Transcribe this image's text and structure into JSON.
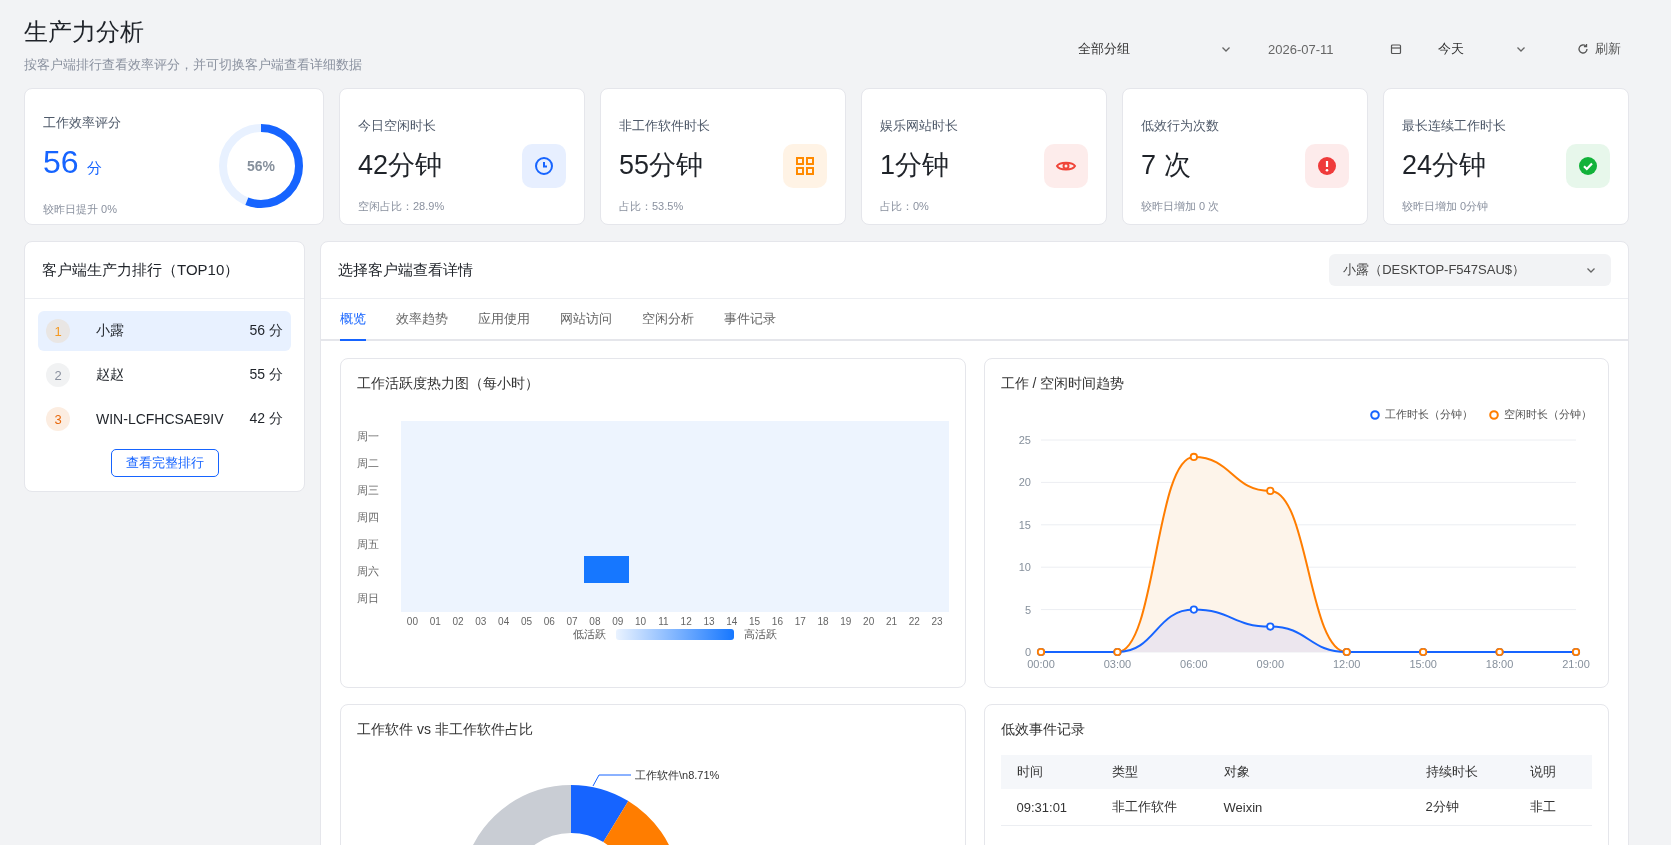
{
  "page": {
    "title": "生产力分析",
    "subtitle": "按客户端排行查看效率评分，并可切换客户端查看详细数据"
  },
  "filters": {
    "group": "全部分组",
    "date": "2026-07-11",
    "range": "今天",
    "refresh": "刷新"
  },
  "stats": [
    {
      "kind": "ring",
      "label": "工作效率评分",
      "value": "56",
      "unit": "分",
      "note": "较昨日提升 0%",
      "level": 0.56,
      "ring_text": "56%"
    },
    {
      "kind": "clock",
      "label": "今日空闲时长",
      "value": "42分钟",
      "note": "空闲占比：28.9%",
      "color": "#1664ff"
    },
    {
      "kind": "grid",
      "label": "非工作软件时长",
      "value": "55分钟",
      "note": "占比：53.5%",
      "color": "#ff8a00"
    },
    {
      "kind": "eye",
      "label": "娱乐网站时长",
      "value": "1分钟",
      "note": "占比：0%",
      "color": "#f04438"
    },
    {
      "kind": "alert",
      "label": "低效行为次数",
      "value": "7 次",
      "note": "较昨日增加 0 次",
      "color": "#ef3b3b"
    },
    {
      "kind": "check",
      "label": "最长连续工作时长",
      "value": "24分钟",
      "note": "较昨日增加 0分钟",
      "color": "#12b23a"
    }
  ],
  "ranking": {
    "title": "客户端生产力排行（TOP10）",
    "items": [
      {
        "rank": "1",
        "name": "小露",
        "score": "56 分",
        "selected": true,
        "color": "#f59a23"
      },
      {
        "rank": "2",
        "name": "赵赵",
        "score": "55 分",
        "selected": false,
        "color": "#8a919f"
      },
      {
        "rank": "3",
        "name": "WIN-LCFHCSAE9IV",
        "score": "42 分",
        "selected": false,
        "color": "#e8680c"
      }
    ],
    "more": "查看完整排行"
  },
  "detail": {
    "title": "选择客户端查看详情",
    "client": "小露（DESKTOP-F547SAU$）",
    "tabs": [
      {
        "label": "概览",
        "selected": true
      },
      {
        "label": "效率趋势",
        "selected": false
      },
      {
        "label": "应用使用",
        "selected": false
      },
      {
        "label": "网站访问",
        "selected": false
      },
      {
        "label": "空闲分析",
        "selected": false
      },
      {
        "label": "事件记录",
        "selected": false
      }
    ],
    "heatmap": {
      "title": "工作活跃度热力图（每小时）",
      "columns": [
        "00",
        "01",
        "02",
        "03",
        "04",
        "05",
        "06",
        "07",
        "08",
        "09",
        "10",
        "11",
        "12",
        "13",
        "14",
        "15",
        "16",
        "17",
        "18",
        "19",
        "20",
        "21",
        "22",
        "23"
      ],
      "rows": [
        {
          "label": "周一",
          "active": [
            false,
            false,
            false,
            false,
            false,
            false,
            false,
            false,
            false,
            false,
            false,
            false,
            false,
            false,
            false,
            false,
            false,
            false,
            false,
            false,
            false,
            false,
            false,
            false
          ]
        },
        {
          "label": "周二",
          "active": [
            false,
            false,
            false,
            false,
            false,
            false,
            false,
            false,
            false,
            false,
            false,
            false,
            false,
            false,
            false,
            false,
            false,
            false,
            false,
            false,
            false,
            false,
            false,
            false
          ]
        },
        {
          "label": "周三",
          "active": [
            false,
            false,
            false,
            false,
            false,
            false,
            false,
            false,
            false,
            false,
            false,
            false,
            false,
            false,
            false,
            false,
            false,
            false,
            false,
            false,
            false,
            false,
            false,
            false
          ]
        },
        {
          "label": "周四",
          "active": [
            false,
            false,
            false,
            false,
            false,
            false,
            false,
            false,
            false,
            false,
            false,
            false,
            false,
            false,
            false,
            false,
            false,
            false,
            false,
            false,
            false,
            false,
            false,
            false
          ]
        },
        {
          "label": "周五",
          "active": [
            false,
            false,
            false,
            false,
            false,
            false,
            false,
            false,
            false,
            false,
            false,
            false,
            false,
            false,
            false,
            false,
            false,
            false,
            false,
            false,
            false,
            false,
            false,
            false
          ]
        },
        {
          "label": "周六",
          "active": [
            false,
            false,
            false,
            false,
            false,
            false,
            false,
            false,
            true,
            true,
            false,
            false,
            false,
            false,
            false,
            false,
            false,
            false,
            false,
            false,
            false,
            false,
            false,
            false
          ]
        },
        {
          "label": "周日",
          "active": [
            false,
            false,
            false,
            false,
            false,
            false,
            false,
            false,
            false,
            false,
            false,
            false,
            false,
            false,
            false,
            false,
            false,
            false,
            false,
            false,
            false,
            false,
            false,
            false
          ]
        }
      ],
      "legend_low": "低活跃",
      "legend_high": "高活跃"
    },
    "trend": {
      "title": "工作 / 空闲时间趋势",
      "chart_data": {
        "type": "area",
        "categories": [
          "00:00",
          "03:00",
          "06:00",
          "09:00",
          "12:00",
          "15:00",
          "18:00",
          "21:00"
        ],
        "ylim": [
          0,
          25
        ],
        "grid": true,
        "yticks": [
          0,
          5,
          10,
          15,
          20,
          25
        ],
        "series": [
          {
            "name": "工作时长（分钟）",
            "color": "#1664ff",
            "values": [
              0,
              0,
              5,
              3,
              0,
              0,
              0,
              0
            ]
          },
          {
            "name": "空闲时长（分钟）",
            "color": "#ff7d00",
            "values": [
              0,
              0,
              23,
              19,
              0,
              0,
              0,
              0
            ]
          }
        ]
      }
    },
    "share": {
      "title": "工作软件 vs 非工作软件占比",
      "label": "工作软件\\n8.71%"
    },
    "events": {
      "title": "低效事件记录",
      "columns": [
        "时间",
        "类型",
        "对象",
        "持续时长",
        "说明"
      ],
      "rows": [
        [
          "09:31:01",
          "非工作软件",
          "Weixin",
          "2分钟",
          "非工"
        ]
      ]
    }
  }
}
